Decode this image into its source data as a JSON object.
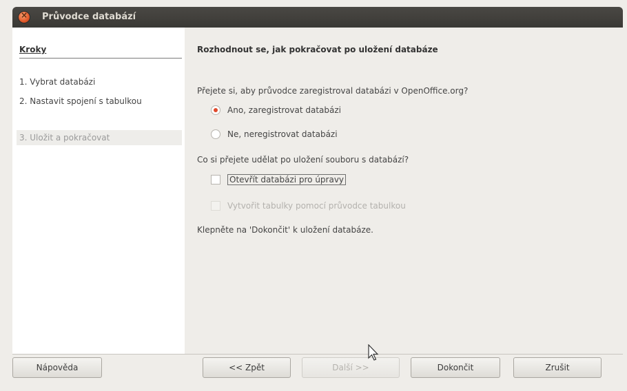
{
  "window": {
    "title": "Průvodce databází"
  },
  "steps": {
    "heading": "Kroky",
    "items": [
      "1. Vybrat databázi",
      "2. Nastavit spojení s tabulkou",
      "3. Uložit a pokračovat"
    ]
  },
  "main": {
    "heading": "Rozhodnout se, jak pokračovat po uložení databáze",
    "q1": "Přejete si, aby průvodce zaregistroval databázi v OpenOffice.org?",
    "opt_yes": "Ano, zaregistrovat databázi",
    "opt_no": "Ne, neregistrovat databázi",
    "q2": "Co si přejete udělat po uložení souboru s databází?",
    "opt_open": "Otevřít databázi pro úpravy",
    "opt_create": "Vytvořit tabulky pomocí průvodce tabulkou",
    "note": "Klepněte na 'Dokončit' k uložení databáze."
  },
  "buttons": {
    "help": "Nápověda",
    "back": "<< Zpět",
    "next": "Další >>",
    "finish": "Dokončit",
    "cancel": "Zrušit"
  },
  "colors": {
    "accent": "#e0492b",
    "titlebar": "#3c3b37"
  }
}
